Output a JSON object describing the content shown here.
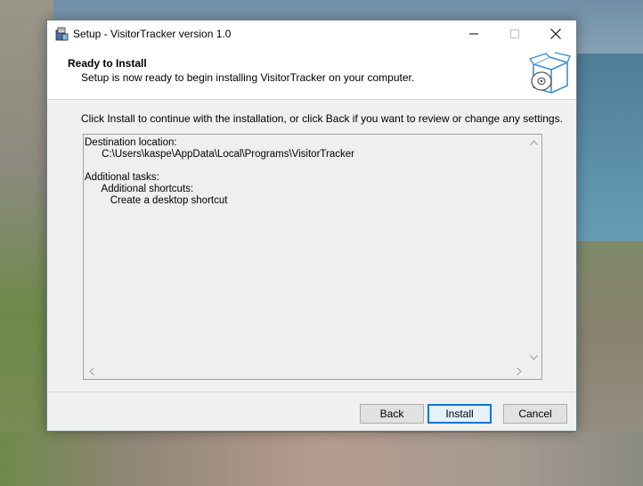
{
  "window": {
    "title": "Setup - VisitorTracker version 1.0"
  },
  "header": {
    "title": "Ready to Install",
    "subtitle": "Setup is now ready to begin installing VisitorTracker on your computer."
  },
  "instruction": "Click Install to continue with the installation, or click Back if you want to review or change any settings.",
  "memo": {
    "lines": [
      "Destination location:",
      "      C:\\Users\\kaspe\\AppData\\Local\\Programs\\VisitorTracker",
      "",
      "Additional tasks:",
      "      Additional shortcuts:",
      "         Create a desktop shortcut"
    ]
  },
  "buttons": {
    "back": "Back",
    "install": "Install",
    "cancel": "Cancel"
  },
  "colors": {
    "window_bg": "#f0f0f0",
    "accent": "#0078d7",
    "icon_blue": "#3d8fd6"
  },
  "icons": {
    "app": "installer-icon",
    "header": "package-disc-icon"
  }
}
